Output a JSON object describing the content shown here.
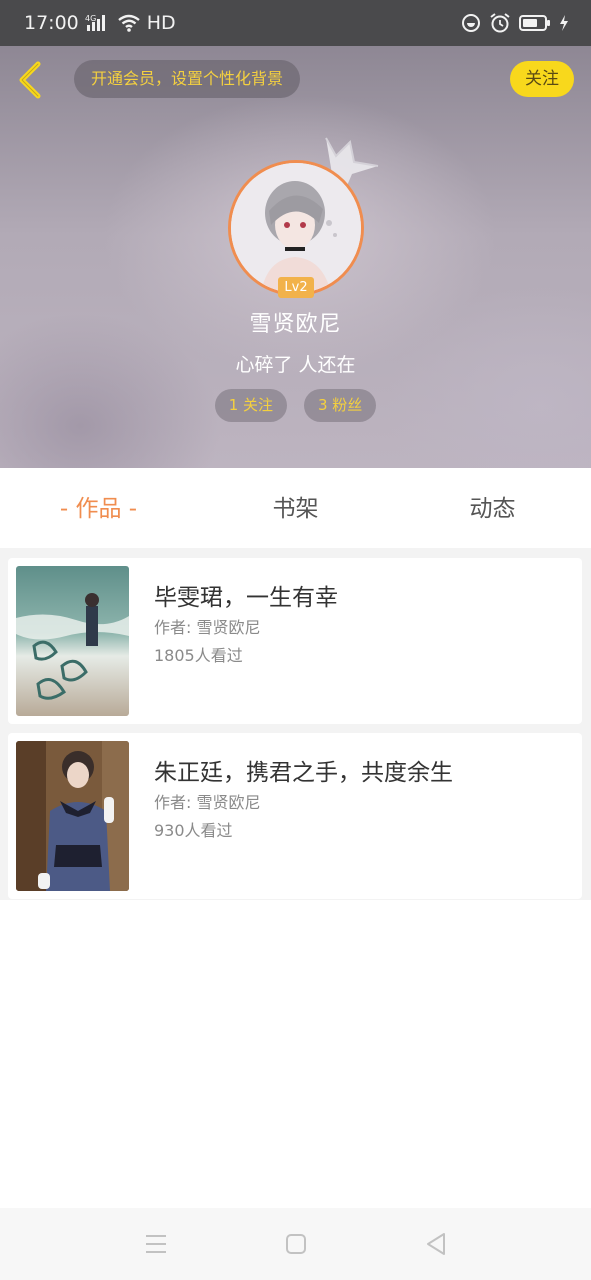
{
  "status_bar": {
    "time": "17:00",
    "network_label": "HD",
    "icons": [
      "4g-signal-icon",
      "wifi-icon",
      "vpn-icon",
      "alarm-icon",
      "battery-icon",
      "charging-icon"
    ]
  },
  "header": {
    "vip_banner": "开通会员，设置个性化背景",
    "follow_label": "关注",
    "level": "Lv2",
    "username": "雪贤欧尼",
    "signature": "心碎了 人还在",
    "following": "1 关注",
    "fans": "3 粉丝"
  },
  "tabs": [
    {
      "label": "- 作品 -",
      "active": true
    },
    {
      "label": "书架",
      "active": false
    },
    {
      "label": "动态",
      "active": false
    }
  ],
  "works": [
    {
      "title": "毕雯珺，一生有幸",
      "author": "作者: 雪贤欧尼",
      "views": "1805人看过"
    },
    {
      "title": "朱正廷，携君之手，共度余生",
      "author": "作者: 雪贤欧尼",
      "views": "930人看过"
    }
  ],
  "colors": {
    "accent_orange": "#f08d4f",
    "follow_yellow": "#f8d81c",
    "badge_gold": "#f4d03f"
  }
}
